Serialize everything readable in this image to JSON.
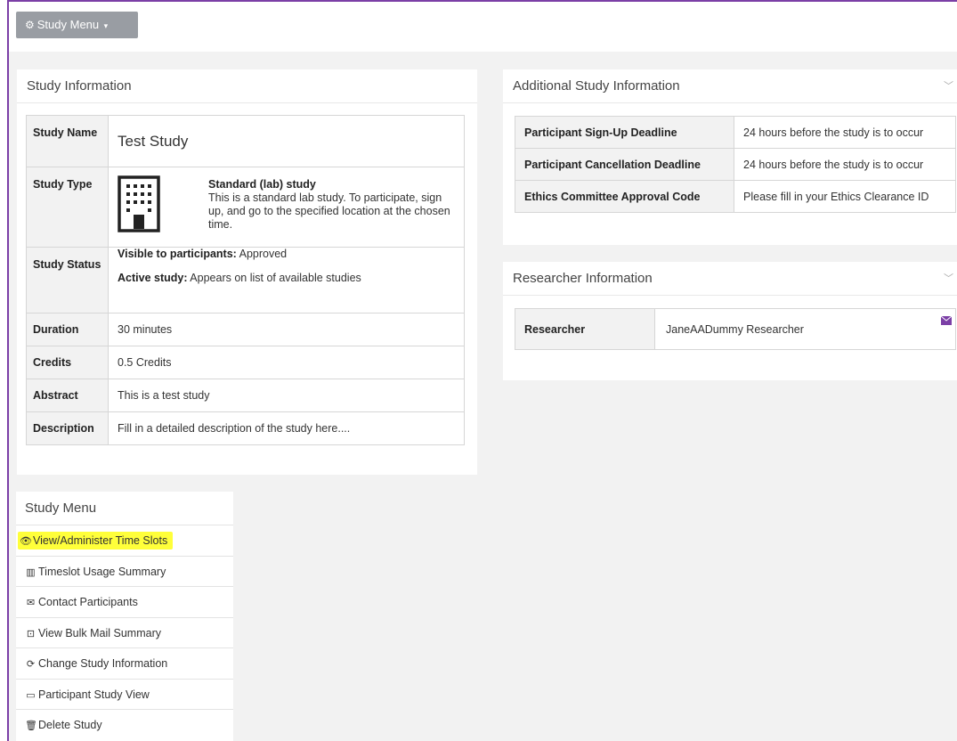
{
  "toolbar": {
    "study_menu_label": "Study Menu"
  },
  "study_info": {
    "title": "Study Information",
    "rows": {
      "name": {
        "label": "Study Name",
        "value": "Test Study"
      },
      "type": {
        "label": "Study Type",
        "type_title": "Standard (lab) study",
        "type_desc": "This is a standard lab study. To participate, sign up, and go to the specified location at the chosen time."
      },
      "status": {
        "label": "Study Status",
        "visible_label": "Visible to participants:",
        "visible_value": "Approved",
        "active_label": "Active study:",
        "active_value": "Appears on list of available studies"
      },
      "duration": {
        "label": "Duration",
        "value": "30 minutes"
      },
      "credits": {
        "label": "Credits",
        "value": "0.5 Credits"
      },
      "abstract": {
        "label": "Abstract",
        "value": "This is a test study"
      },
      "description": {
        "label": "Description",
        "value": "Fill in a detailed description of the study here...."
      }
    }
  },
  "additional_info": {
    "title": "Additional Study Information",
    "rows": [
      {
        "label": "Participant Sign-Up Deadline",
        "value": "24 hours before the study is to occur"
      },
      {
        "label": "Participant Cancellation Deadline",
        "value": "24 hours before the study is to occur"
      },
      {
        "label": "Ethics Committee Approval Code",
        "value": "Please fill in your Ethics Clearance ID"
      }
    ]
  },
  "researcher_info": {
    "title": "Researcher Information",
    "label": "Researcher",
    "value": "JaneAADummy Researcher"
  },
  "study_menu": {
    "title": "Study Menu",
    "items": [
      {
        "label": "View/Administer Time Slots",
        "icon": "eye-icon"
      },
      {
        "label": "Timeslot Usage Summary",
        "icon": "bar-chart-icon"
      },
      {
        "label": "Contact Participants",
        "icon": "envelope-icon"
      },
      {
        "label": "View Bulk Mail Summary",
        "icon": "inbox-icon"
      },
      {
        "label": "Change Study Information",
        "icon": "refresh-icon"
      },
      {
        "label": "Participant Study View",
        "icon": "laptop-icon"
      },
      {
        "label": "Delete Study",
        "icon": "trash-icon"
      }
    ]
  },
  "colors": {
    "accent": "#7b3fa6",
    "highlight": "#ffff3a",
    "button": "#999da3"
  }
}
